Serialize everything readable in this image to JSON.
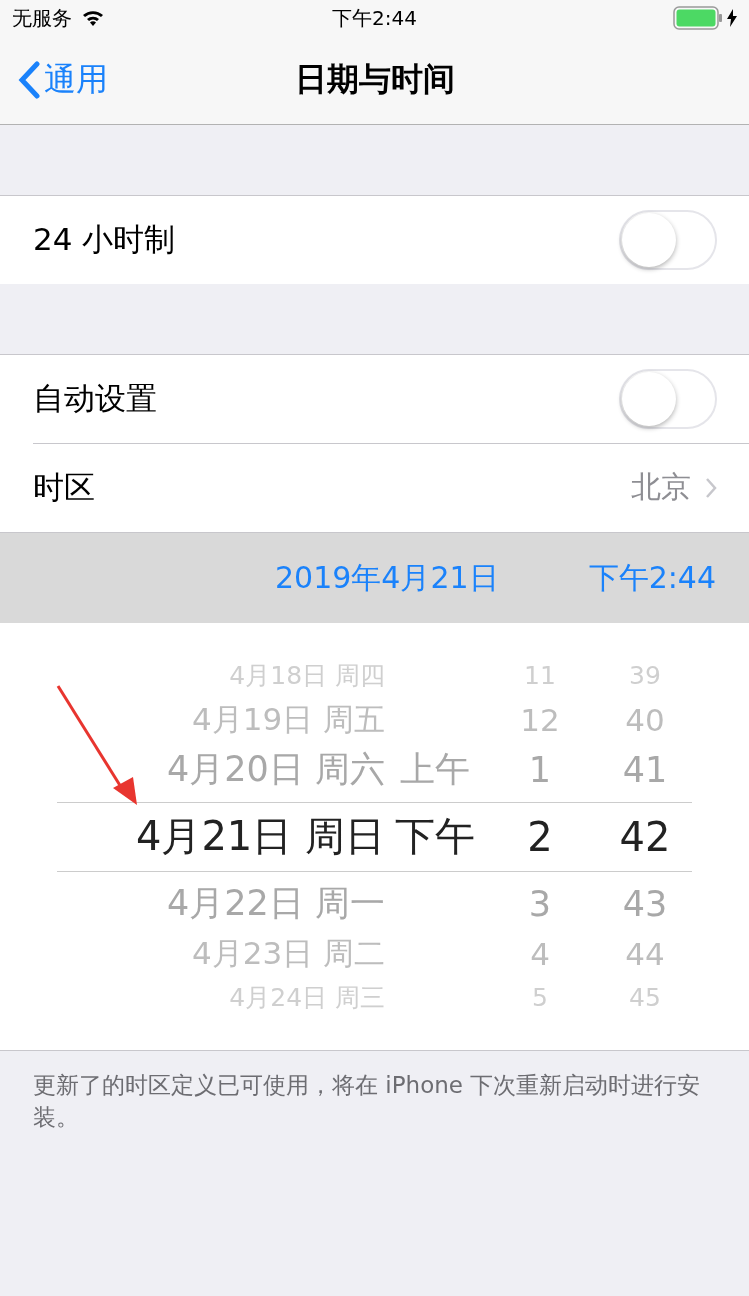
{
  "status_bar": {
    "carrier": "无服务",
    "time": "下午2:44",
    "charging": true
  },
  "nav": {
    "back": "通用",
    "title": "日期与时间"
  },
  "settings": [
    {
      "kind": "toggle",
      "label": "24 小时制",
      "on": false,
      "group_start": true
    },
    {
      "kind": "toggle",
      "label": "自动设置",
      "on": false,
      "group_start": true
    },
    {
      "kind": "link",
      "label": "时区",
      "value": "北京",
      "group_start": false
    }
  ],
  "date_bar": {
    "date": "2019年4月21日",
    "time": "下午2:44"
  },
  "picker": [
    {
      "date": "4月18日 周四",
      "hour": "11",
      "minute": "39",
      "selected": false
    },
    {
      "date": "4月19日 周五",
      "hour": "12",
      "minute": "40",
      "selected": false
    },
    {
      "date": "4月20日 周六",
      "ampm": "上午",
      "hour": "1",
      "minute": "41",
      "selected": false
    },
    {
      "date": "4月21日 周日",
      "ampm": "下午",
      "hour": "2",
      "minute": "42",
      "selected": true
    },
    {
      "date": "4月22日 周一",
      "hour": "3",
      "minute": "43",
      "selected": false
    },
    {
      "date": "4月23日 周二",
      "hour": "4",
      "minute": "44",
      "selected": false
    },
    {
      "date": "4月24日 周三",
      "hour": "5",
      "minute": "45",
      "selected": false
    }
  ],
  "footer_note": "更新了的时区定义已可使用，将在 iPhone 下次重新启动时进行安装。"
}
